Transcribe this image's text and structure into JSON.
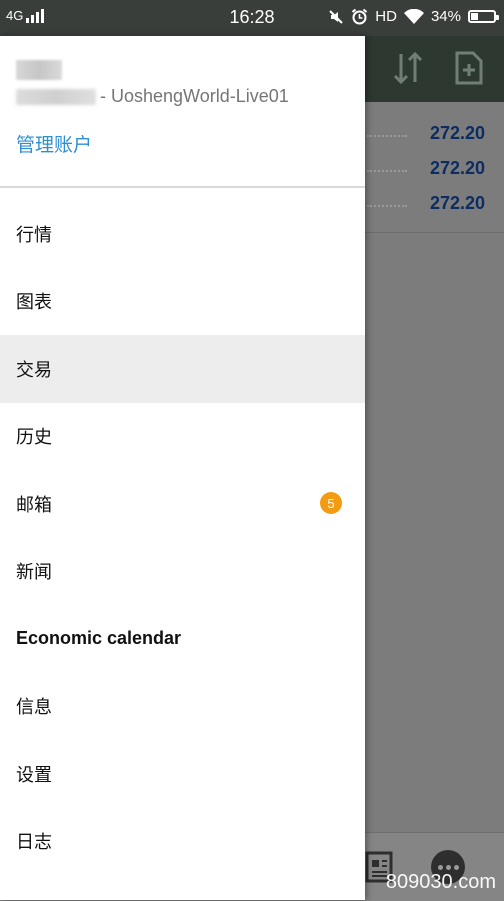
{
  "status_bar": {
    "network": "4G",
    "time": "16:28",
    "hd": "HD",
    "battery_percent": "34%",
    "battery_level": 0.34
  },
  "background": {
    "quotes": [
      "272.20",
      "272.20",
      "272.20"
    ],
    "watermark": "809030.com"
  },
  "drawer": {
    "account_line": "- UoshengWorld-Live01",
    "manage_accounts": "管理账户",
    "menu": [
      {
        "label": "行情"
      },
      {
        "label": "图表"
      },
      {
        "label": "交易",
        "active": true
      },
      {
        "label": "历史"
      },
      {
        "label": "邮箱",
        "badge": "5"
      },
      {
        "label": "新闻"
      },
      {
        "label": "Economic calendar"
      },
      {
        "label": "信息"
      },
      {
        "label": "设置"
      },
      {
        "label": "日志"
      }
    ]
  },
  "colors": {
    "accent": "#2f8fd3",
    "badge": "#f39c12",
    "quote": "#0c2c62"
  }
}
